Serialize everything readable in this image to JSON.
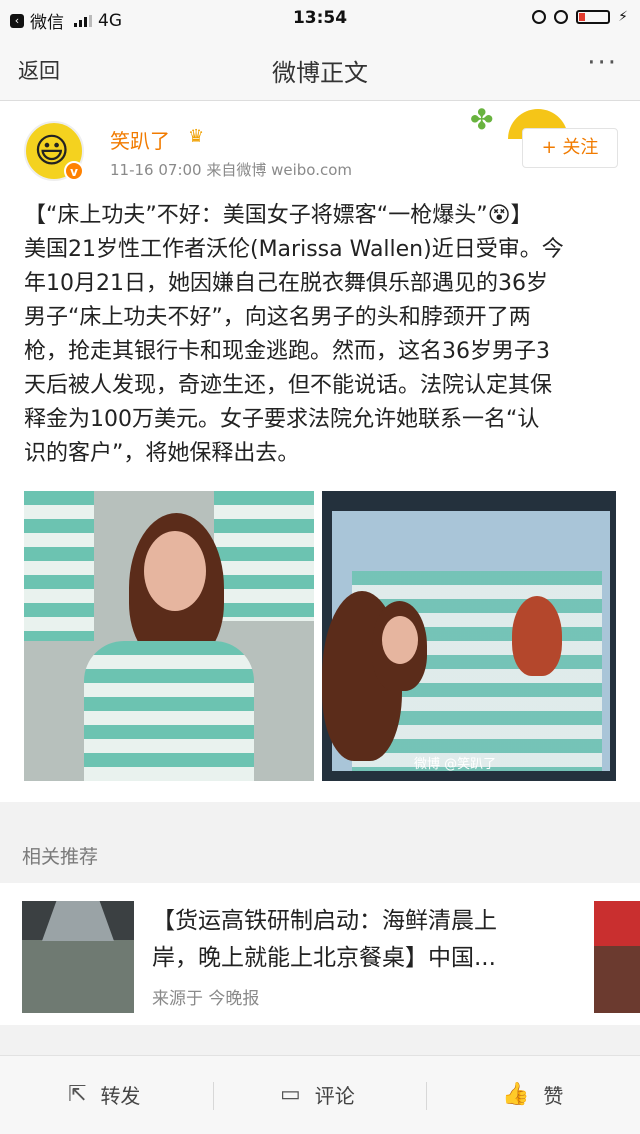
{
  "status_bar": {
    "app_back_label": "微信",
    "network": "4G",
    "time": "13:54"
  },
  "nav": {
    "back_label": "返回",
    "title": "微博正文",
    "more_label": "···"
  },
  "post": {
    "username": "笑趴了",
    "crown_icon": "crown-icon",
    "meta": "11-16 07:00  来自微博 weibo.com",
    "follow_label": "+ 关注",
    "text_lines": [
      "【“床上功夫”不好：美国女子将嫖客“一枪爆头”😵】",
      "美国21岁性工作者沃伦(Marissa Wallen)近日受审。今",
      "年10月21日，她因嫌自己在脱衣舞俱乐部遇见的36岁",
      "男子“床上功夫不好”，向这名男子的头和脖颈开了两",
      "枪，抢走其银行卡和现金逃跑。然而，这名36岁男子3",
      "天后被人发现，奇迹生还，但不能说话。法院认定其保",
      "释金为100万美元。女子要求法院允许她联系一名“认",
      "识的客户”，将她保释出去。"
    ],
    "photo_watermark": "微博 @笑趴了"
  },
  "recommend": {
    "section_title": "相关推荐",
    "headline_lines": [
      "【货运高铁研制启动：海鲜清晨上",
      "岸，晚上就能上北京餐桌】中国..."
    ],
    "source": "来源于 今晚报"
  },
  "toolbar": {
    "repost_label": "转发",
    "comment_label": "评论",
    "like_label": "赞"
  },
  "colors": {
    "accent_orange": "#f17b00",
    "verified_badge": "#ff8200"
  }
}
